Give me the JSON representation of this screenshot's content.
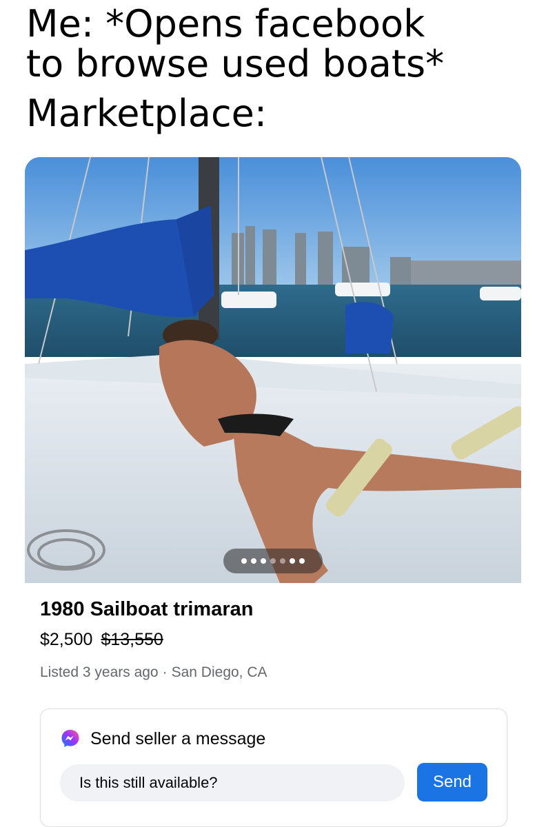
{
  "caption": {
    "line1": "Me: *Opens facebook",
    "line2": "to browse used boats*",
    "line3": "Marketplace:"
  },
  "photo": {
    "alt": "Listing photo",
    "carousel": {
      "total": 7,
      "active": 3
    }
  },
  "listing": {
    "title": "1980 Sailboat trimaran",
    "price": "$2,500",
    "original_price": "$13,550",
    "listed": "Listed 3 years ago",
    "separator": "·",
    "location": "San Diego, CA"
  },
  "message": {
    "header": "Send seller a message",
    "icon": "messenger-icon",
    "input_value": "Is this still available?",
    "send_label": "Send"
  },
  "colors": {
    "accent": "#1b74e4",
    "muted_text": "#65676b",
    "input_bg": "#f0f2f5"
  }
}
